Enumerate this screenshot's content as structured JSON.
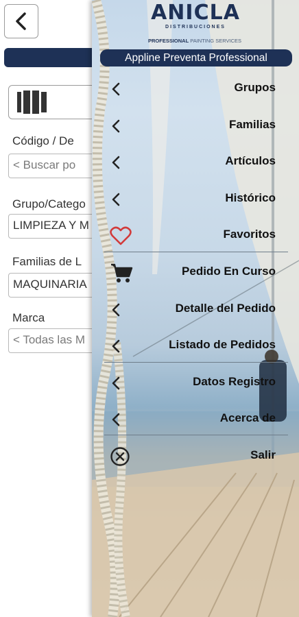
{
  "background_form": {
    "fields": [
      {
        "label": "Código / De",
        "value": "< Buscar po",
        "is_placeholder": true
      },
      {
        "label": "Grupo/Catego",
        "value": "LIMPIEZA Y M",
        "is_placeholder": false
      },
      {
        "label": "Familias de L",
        "value": "MAQUINARIA",
        "is_placeholder": false
      },
      {
        "label": "Marca",
        "value": "< Todas las M",
        "is_placeholder": true
      }
    ]
  },
  "drawer": {
    "logo": {
      "name": "ANICLA",
      "subtitle": "DISTRIBUCIONES",
      "tagline_bold": "PROFESSIONAL",
      "tagline_rest": " PAINTING SERVICES"
    },
    "app_name": "Appline Preventa Professional",
    "menu": [
      {
        "label": "Grupos",
        "icon": "chevron-left-icon"
      },
      {
        "label": "Familias",
        "icon": "chevron-left-icon"
      },
      {
        "label": "Artículos",
        "icon": "chevron-left-icon"
      },
      {
        "label": "Histórico",
        "icon": "chevron-left-icon"
      },
      {
        "label": "Favoritos",
        "icon": "heart-icon"
      },
      {
        "label": "Pedido En Curso",
        "icon": "cart-icon"
      },
      {
        "label": "Detalle del Pedido",
        "icon": "chevron-left-icon"
      },
      {
        "label": "Listado de Pedidos",
        "icon": "chevron-left-icon"
      },
      {
        "label": "Datos Registro",
        "icon": "chevron-left-icon"
      },
      {
        "label": "Acerca de",
        "icon": "chevron-left-icon"
      },
      {
        "label": "Salir",
        "icon": "close-circle-icon"
      }
    ]
  },
  "colors": {
    "brand_navy": "#1e3156",
    "favorite_red": "#d23a3a"
  }
}
